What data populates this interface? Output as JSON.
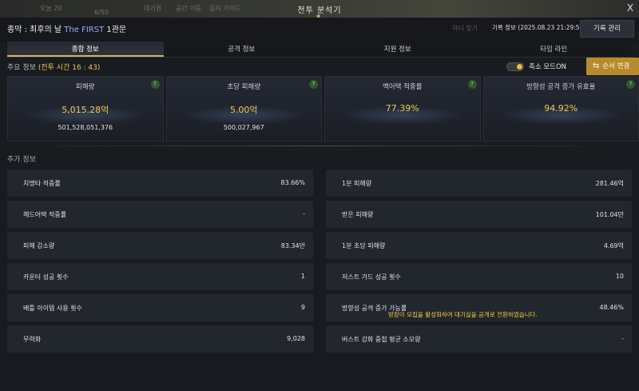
{
  "window": {
    "title": "전투 분석기",
    "close": "X"
  },
  "background": {
    "t1": "오늘 20",
    "t2": "6/50",
    "t3": "대기권",
    "t4": "공간 이동",
    "t5": "길지 가이드"
  },
  "header": {
    "record_prefix": "종막 : 최후의 날 ",
    "record_highlight": "The FIRST",
    "record_suffix": " 1관문",
    "faded_text": "하디 찾기",
    "record_info": "기록 정보 (2025.08.23 21:29:57)",
    "record_button": "기록 관리"
  },
  "tabs": [
    {
      "label": "종합 정보",
      "active": true
    },
    {
      "label": "공격 정보",
      "active": false
    },
    {
      "label": "지원 정보",
      "active": false
    },
    {
      "label": "타임 라인",
      "active": false
    }
  ],
  "main": {
    "label": "주요 정보",
    "battle_time": "(전투 시간 16 : 43)",
    "toggle_label": "축소 모드ON",
    "order_button": "순서 변경"
  },
  "cards": [
    {
      "label": "피해량",
      "value": "5,015.28억",
      "sub": "501,528,051,376",
      "help": "?"
    },
    {
      "label": "초당 피해량",
      "value": "5.00억",
      "sub": "500,027,967",
      "help": "?"
    },
    {
      "label": "백어택 적중률",
      "value": "77.39%",
      "sub": "",
      "help": "?"
    },
    {
      "label": "방향성 공격 증가 유효율",
      "value": "94.92%",
      "sub": "",
      "help": "?"
    }
  ],
  "extra": {
    "title": "추가 정보",
    "left": [
      {
        "key": "치명타 적중률",
        "value": "83.66%"
      },
      {
        "key": "헤드어택 적중률",
        "value": "-"
      },
      {
        "key": "피해 감소량",
        "value": "83.34만"
      },
      {
        "key": "카운터 성공 횟수",
        "value": "1"
      },
      {
        "key": "배틀 아이템 사용 횟수",
        "value": "9"
      },
      {
        "key": "무력화",
        "value": "9,028"
      }
    ],
    "right": [
      {
        "key": "1분 피해량",
        "value": "281.46억"
      },
      {
        "key": "받은 피해량",
        "value": "101.04만"
      },
      {
        "key": "1분 초당 피해량",
        "value": "4.69억"
      },
      {
        "key": "저스트 가드 성공 횟수",
        "value": "10"
      },
      {
        "key": "방향성 공격 증가 가능률",
        "value": "48.46%"
      },
      {
        "key": "버스트 강화 중첩 평균 소모량",
        "value": "-"
      }
    ]
  },
  "notice": "방장이 모집을 활성화하여 대기실을 공개로 전환하였습니다.",
  "colors": {
    "accent_gold": "#f2c94c",
    "button_gold": "#b88a2e",
    "highlight_blue": "#9fa8ff"
  }
}
